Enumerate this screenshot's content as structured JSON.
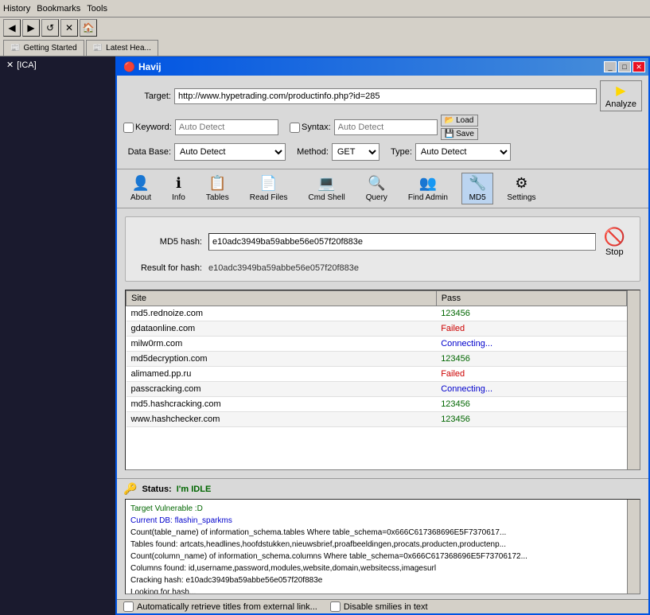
{
  "taskbar": {
    "items": [
      "History",
      "Bookmarks",
      "Tools"
    ]
  },
  "browser": {
    "tabs": [
      {
        "id": "getting-started",
        "label": "Getting Started"
      },
      {
        "id": "latest-head",
        "label": "Latest Hea..."
      }
    ],
    "side_items": [
      {
        "id": "ica",
        "label": "[ICA]"
      }
    ]
  },
  "window": {
    "title": "Havij",
    "title_icon": "🔴"
  },
  "form": {
    "target_label": "Target:",
    "target_value": "http://www.hypetrading.com/productinfo.php?id=285",
    "analyze_label": "Analyze",
    "keyword_label": "Keyword:",
    "keyword_placeholder": "Auto Detect",
    "syntax_label": "Syntax:",
    "syntax_placeholder": "Auto Detect",
    "database_label": "Data Base:",
    "database_value": "Auto Detect",
    "method_label": "Method:",
    "method_value": "GET",
    "type_label": "Type:",
    "type_value": "Auto Detect",
    "load_label": "Load",
    "save_label": "Save"
  },
  "toolbar": {
    "buttons": [
      {
        "id": "about",
        "label": "About",
        "icon": "👤"
      },
      {
        "id": "info",
        "label": "Info",
        "icon": "ℹ"
      },
      {
        "id": "tables",
        "label": "Tables",
        "icon": "📋"
      },
      {
        "id": "read-files",
        "label": "Read Files",
        "icon": "📄"
      },
      {
        "id": "cmd-shell",
        "label": "Cmd Shell",
        "icon": "💻"
      },
      {
        "id": "query",
        "label": "Query",
        "icon": "🔍"
      },
      {
        "id": "find-admin",
        "label": "Find Admin",
        "icon": "👥"
      },
      {
        "id": "md5",
        "label": "MD5",
        "icon": "🔧",
        "active": true
      },
      {
        "id": "settings",
        "label": "Settings",
        "icon": "⚙"
      }
    ]
  },
  "md5": {
    "hash_label": "MD5 hash:",
    "hash_value": "e10adc3949ba59abbe56e057f20f883e",
    "result_label": "Result for hash:",
    "result_value": "e10adc3949ba59abbe56e057f20f883e",
    "stop_label": "Stop"
  },
  "sites_table": {
    "columns": [
      "Site",
      "Pass"
    ],
    "rows": [
      {
        "site": "md5.rednoize.com",
        "pass": "123456"
      },
      {
        "site": "gdataonline.com",
        "pass": "Failed"
      },
      {
        "site": "milw0rm.com",
        "pass": "Connecting..."
      },
      {
        "site": "md5decryption.com",
        "pass": "123456"
      },
      {
        "site": "alimamed.pp.ru",
        "pass": "Failed"
      },
      {
        "site": "passcracking.com",
        "pass": "Connecting..."
      },
      {
        "site": "md5.hashcracking.com",
        "pass": "123456"
      },
      {
        "site": "www.hashchecker.com",
        "pass": "123456"
      }
    ]
  },
  "status": {
    "label": "Status:",
    "value": "I'm IDLE"
  },
  "log": {
    "lines": [
      {
        "color": "green",
        "text": "Target Vulnerable :D"
      },
      {
        "color": "blue",
        "text": "Current DB: flashin_sparkms"
      },
      {
        "color": "black",
        "text": "Count(table_name) of information_schema.tables Where table_schema=0x666C617368696E5F7370617..."
      },
      {
        "color": "black",
        "text": "Tables found: artcats,headlines,hoofdstukken,nieuwsbrief,proafbeeldingen,procats,producten,productenp..."
      },
      {
        "color": "black",
        "text": "Count(column_name) of information_schema.columns Where table_schema=0x666C617368696E5F73706172..."
      },
      {
        "color": "black",
        "text": "Columns found: id,username,password,modules,website,domain,websitecss,imagesurl"
      },
      {
        "color": "black",
        "text": "Cracking hash: e10adc3949ba59abbe56e057f20f883e"
      },
      {
        "color": "black",
        "text": "Looking for hash..."
      }
    ]
  },
  "bottom": {
    "checkbox1_label": "Automatically retrieve titles from external link...",
    "checkbox2_label": "Disable smilies in text"
  }
}
